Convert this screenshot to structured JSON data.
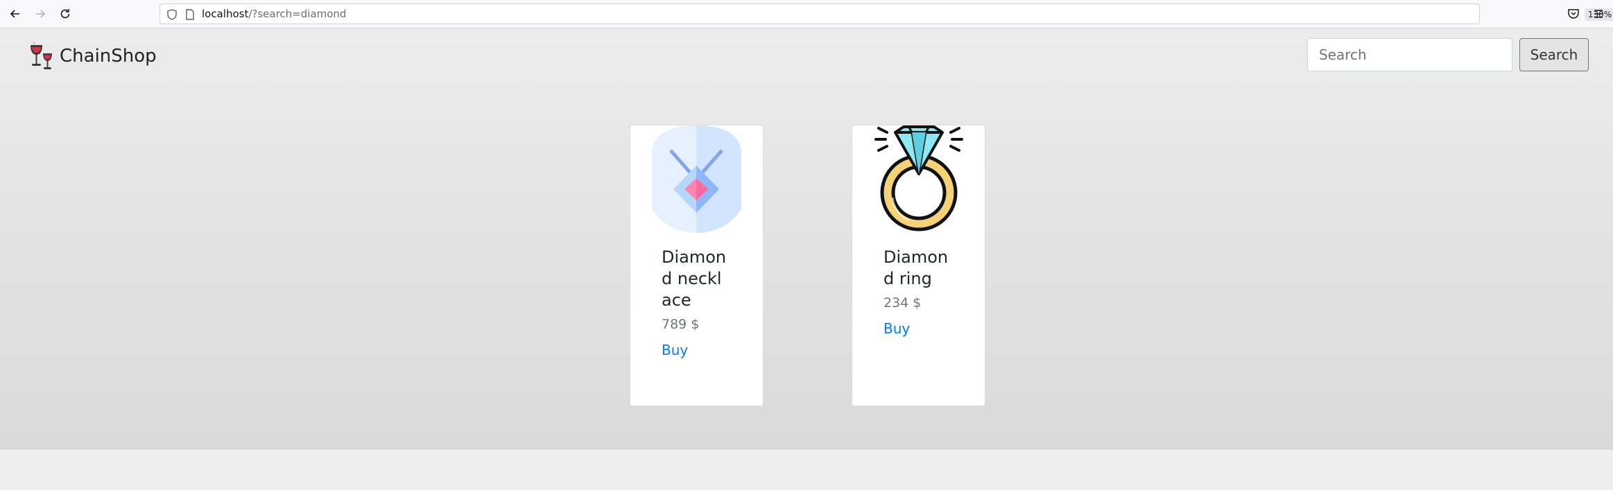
{
  "browser": {
    "url_host": "localhost",
    "url_path": "/?search=diamond",
    "zoom": "130%"
  },
  "site": {
    "brand": "ChainShop",
    "search": {
      "placeholder": "Search",
      "value": "",
      "button_label": "Search"
    }
  },
  "products": [
    {
      "title": "Diamond necklace",
      "price": "789 $",
      "action": "Buy",
      "icon": "diamond-necklace-icon"
    },
    {
      "title": "Diamond ring",
      "price": "234 $",
      "action": "Buy",
      "icon": "diamond-ring-icon"
    }
  ],
  "colors": {
    "link": "#007bff",
    "price": "#6c757d",
    "ring_gold": "#f5d276",
    "diamond_cyan": "#8de8f2",
    "necklace_pink": "#ff7eb3"
  }
}
